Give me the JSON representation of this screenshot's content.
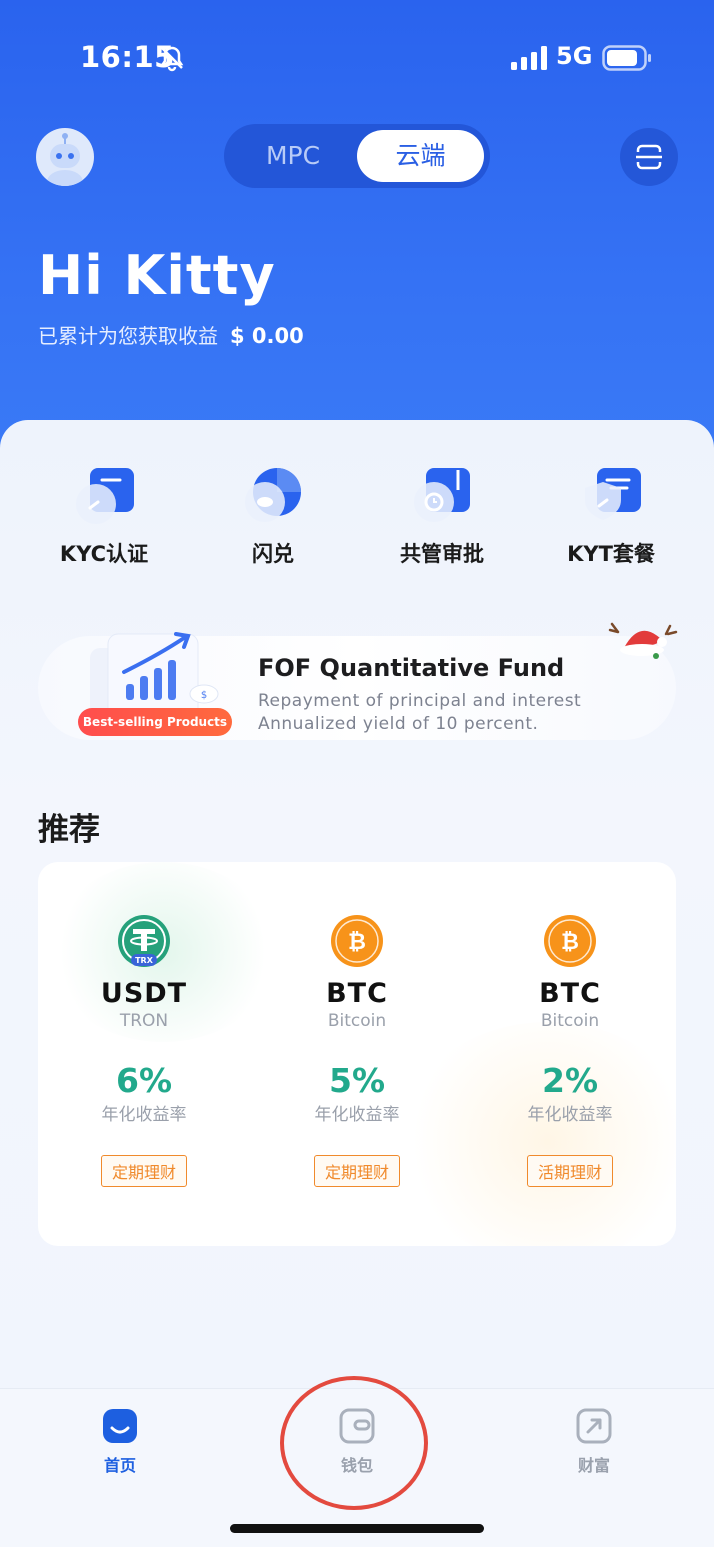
{
  "status_bar": {
    "time": "16:15",
    "network": "5G"
  },
  "header": {
    "segment": {
      "options": [
        "MPC",
        "云端"
      ],
      "selected": "云端"
    },
    "greeting": "Hi Kitty",
    "earnings_label": "已累计为您获取收益",
    "earnings_value": "$ 0.00"
  },
  "shortcuts": [
    {
      "label": "KYC认证",
      "icon": "kyc-icon"
    },
    {
      "label": "闪兑",
      "icon": "swap-icon"
    },
    {
      "label": "共管审批",
      "icon": "approval-icon"
    },
    {
      "label": "KYT套餐",
      "icon": "kyt-icon"
    }
  ],
  "banner": {
    "badge": "Best-selling Products",
    "title": "FOF Quantitative Fund",
    "subtitle_line1": "Repayment of principal and interest",
    "subtitle_line2": "Annualized yield of 10 percent."
  },
  "recommend": {
    "title": "推荐",
    "items": [
      {
        "coin": "USDT",
        "network": "TRON",
        "rate": "6%",
        "rate_label": "年化收益率",
        "tag": "定期理财",
        "icon_badge": "TRX"
      },
      {
        "coin": "BTC",
        "network": "Bitcoin",
        "rate": "5%",
        "rate_label": "年化收益率",
        "tag": "定期理财"
      },
      {
        "coin": "BTC",
        "network": "Bitcoin",
        "rate": "2%",
        "rate_label": "年化收益率",
        "tag": "活期理财"
      }
    ]
  },
  "tabbar": {
    "items": [
      {
        "label": "首页",
        "active": true
      },
      {
        "label": "钱包",
        "active": false
      },
      {
        "label": "财富",
        "active": false
      }
    ]
  },
  "colors": {
    "primary": "#2a63ee",
    "green": "#22a98c",
    "orange": "#f08a2c",
    "annotation": "#e34a3f"
  }
}
